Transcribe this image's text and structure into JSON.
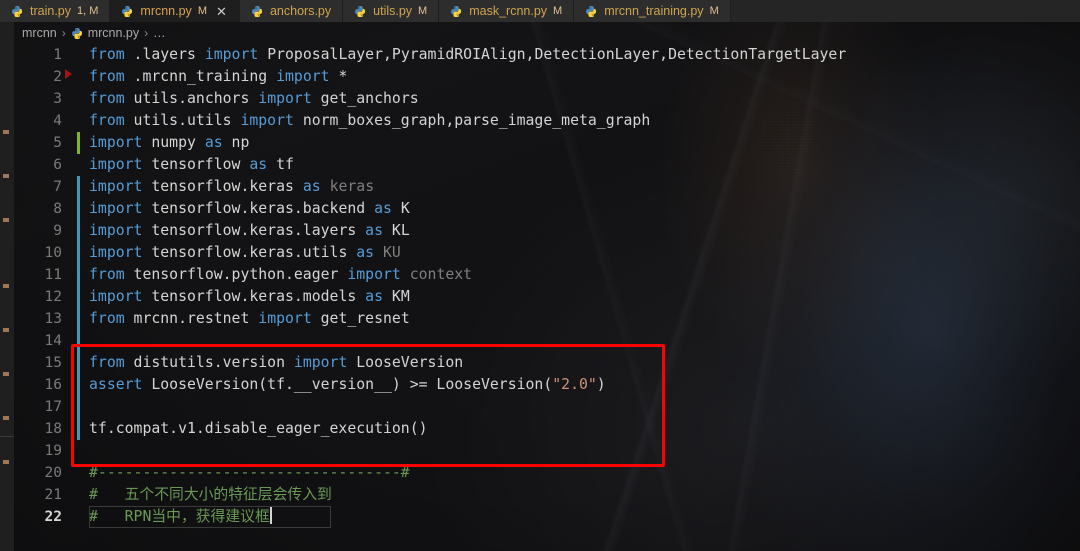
{
  "window": {
    "accent_red": "#ff0000",
    "editor_bg": "#1e1e1e",
    "tabbar_bg": "#252526"
  },
  "tabs": [
    {
      "name": "train.py",
      "label": "train.py",
      "badge": "1, M",
      "active": false,
      "icon": "python-file-icon",
      "closable": false
    },
    {
      "name": "mrcnn.py",
      "label": "mrcnn.py",
      "badge": "M",
      "active": true,
      "icon": "python-file-icon",
      "closable": true,
      "close": "✕"
    },
    {
      "name": "anchors.py",
      "label": "anchors.py",
      "badge": "",
      "active": false,
      "icon": "python-file-icon",
      "closable": false
    },
    {
      "name": "utils.py",
      "label": "utils.py",
      "badge": "M",
      "active": false,
      "icon": "python-file-icon",
      "closable": false
    },
    {
      "name": "mask_rcnn.py",
      "label": "mask_rcnn.py",
      "badge": "M",
      "active": false,
      "icon": "python-file-icon",
      "closable": false
    },
    {
      "name": "mrcnn_training.py",
      "label": "mrcnn_training.py",
      "badge": "M",
      "active": false,
      "icon": "python-file-icon",
      "closable": false
    }
  ],
  "breadcrumb": {
    "folder": "mrcnn",
    "sep1": "›",
    "file": "mrcnn.py",
    "sep2": "›",
    "ellipsis": "…"
  },
  "code": {
    "lines": [
      {
        "n": "1",
        "git": "",
        "breakpoint": false,
        "current": false,
        "tokens": [
          {
            "t": "from",
            "c": "kw"
          },
          {
            "t": " .layers ",
            "c": "plain"
          },
          {
            "t": "import",
            "c": "kw"
          },
          {
            "t": " ProposalLayer,PyramidROIAlign,DetectionLayer,DetectionTargetLayer",
            "c": "plain"
          }
        ]
      },
      {
        "n": "2",
        "git": "",
        "breakpoint": true,
        "current": false,
        "tokens": [
          {
            "t": "from",
            "c": "kw"
          },
          {
            "t": " .mrcnn_training ",
            "c": "plain"
          },
          {
            "t": "import",
            "c": "kw"
          },
          {
            "t": " *",
            "c": "plain"
          }
        ]
      },
      {
        "n": "3",
        "git": "",
        "breakpoint": false,
        "current": false,
        "tokens": [
          {
            "t": "from",
            "c": "kw"
          },
          {
            "t": " utils.anchors ",
            "c": "plain"
          },
          {
            "t": "import",
            "c": "kw"
          },
          {
            "t": " get_anchors",
            "c": "plain"
          }
        ]
      },
      {
        "n": "4",
        "git": "",
        "breakpoint": false,
        "current": false,
        "tokens": [
          {
            "t": "from",
            "c": "kw"
          },
          {
            "t": " utils.utils ",
            "c": "plain"
          },
          {
            "t": "import",
            "c": "kw"
          },
          {
            "t": " norm_boxes_graph,parse_image_meta_graph",
            "c": "plain"
          }
        ]
      },
      {
        "n": "5",
        "git": "add",
        "breakpoint": false,
        "current": false,
        "tokens": [
          {
            "t": "import",
            "c": "kw"
          },
          {
            "t": " numpy ",
            "c": "plain"
          },
          {
            "t": "as",
            "c": "kw"
          },
          {
            "t": " np",
            "c": "plain"
          }
        ]
      },
      {
        "n": "6",
        "git": "",
        "breakpoint": false,
        "current": false,
        "tokens": [
          {
            "t": "import",
            "c": "kw"
          },
          {
            "t": " tensorflow ",
            "c": "plain"
          },
          {
            "t": "as",
            "c": "kw"
          },
          {
            "t": " tf",
            "c": "plain"
          }
        ]
      },
      {
        "n": "7",
        "git": "mod",
        "breakpoint": false,
        "current": false,
        "tokens": [
          {
            "t": "import",
            "c": "kw"
          },
          {
            "t": " tensorflow.keras ",
            "c": "plain"
          },
          {
            "t": "as",
            "c": "kw"
          },
          {
            "t": " ",
            "c": "plain"
          },
          {
            "t": "keras",
            "c": "dim"
          }
        ]
      },
      {
        "n": "8",
        "git": "mod",
        "breakpoint": false,
        "current": false,
        "tokens": [
          {
            "t": "import",
            "c": "kw"
          },
          {
            "t": " tensorflow.keras.backend ",
            "c": "plain"
          },
          {
            "t": "as",
            "c": "kw"
          },
          {
            "t": " K",
            "c": "plain"
          }
        ]
      },
      {
        "n": "9",
        "git": "mod",
        "breakpoint": false,
        "current": false,
        "tokens": [
          {
            "t": "import",
            "c": "kw"
          },
          {
            "t": " tensorflow.keras.layers ",
            "c": "plain"
          },
          {
            "t": "as",
            "c": "kw"
          },
          {
            "t": " KL",
            "c": "plain"
          }
        ]
      },
      {
        "n": "10",
        "git": "mod",
        "breakpoint": false,
        "current": false,
        "tokens": [
          {
            "t": "import",
            "c": "kw"
          },
          {
            "t": " tensorflow.keras.utils ",
            "c": "plain"
          },
          {
            "t": "as",
            "c": "kw"
          },
          {
            "t": " ",
            "c": "plain"
          },
          {
            "t": "KU",
            "c": "dim"
          }
        ]
      },
      {
        "n": "11",
        "git": "mod",
        "breakpoint": false,
        "current": false,
        "tokens": [
          {
            "t": "from",
            "c": "kw"
          },
          {
            "t": " tensorflow.python.eager ",
            "c": "plain"
          },
          {
            "t": "import",
            "c": "kw"
          },
          {
            "t": " ",
            "c": "plain"
          },
          {
            "t": "context",
            "c": "dim"
          }
        ]
      },
      {
        "n": "12",
        "git": "mod",
        "breakpoint": false,
        "current": false,
        "tokens": [
          {
            "t": "import",
            "c": "kw"
          },
          {
            "t": " tensorflow.keras.models ",
            "c": "plain"
          },
          {
            "t": "as",
            "c": "kw"
          },
          {
            "t": " KM",
            "c": "plain"
          }
        ]
      },
      {
        "n": "13",
        "git": "mod",
        "breakpoint": false,
        "current": false,
        "tokens": [
          {
            "t": "from",
            "c": "kw"
          },
          {
            "t": " mrcnn.restnet ",
            "c": "plain"
          },
          {
            "t": "import",
            "c": "kw"
          },
          {
            "t": " get_resnet",
            "c": "plain"
          }
        ]
      },
      {
        "n": "14",
        "git": "mod",
        "breakpoint": false,
        "current": false,
        "tokens": []
      },
      {
        "n": "15",
        "git": "mod",
        "breakpoint": false,
        "current": false,
        "tokens": [
          {
            "t": "from",
            "c": "kw"
          },
          {
            "t": " distutils.version ",
            "c": "plain"
          },
          {
            "t": "import",
            "c": "kw"
          },
          {
            "t": " LooseVersion",
            "c": "plain"
          }
        ]
      },
      {
        "n": "16",
        "git": "mod",
        "breakpoint": false,
        "current": false,
        "tokens": [
          {
            "t": "assert",
            "c": "kw"
          },
          {
            "t": " LooseVersion(tf.__version__) >= LooseVersion(",
            "c": "plain"
          },
          {
            "t": "\"2.0\"",
            "c": "str"
          },
          {
            "t": ")",
            "c": "plain"
          }
        ]
      },
      {
        "n": "17",
        "git": "mod",
        "breakpoint": false,
        "current": false,
        "tokens": []
      },
      {
        "n": "18",
        "git": "mod",
        "breakpoint": false,
        "current": false,
        "tokens": [
          {
            "t": "tf.compat.v1.disable_eager_execution()",
            "c": "plain"
          }
        ]
      },
      {
        "n": "19",
        "git": "",
        "breakpoint": false,
        "current": false,
        "tokens": []
      },
      {
        "n": "20",
        "git": "",
        "breakpoint": false,
        "current": false,
        "tokens": [
          {
            "t": "#----------------------------------#",
            "c": "cmt"
          }
        ]
      },
      {
        "n": "21",
        "git": "",
        "breakpoint": false,
        "current": false,
        "tokens": [
          {
            "t": "#   五个不同大小的特征层会传入到",
            "c": "cmt"
          }
        ]
      },
      {
        "n": "22",
        "git": "",
        "breakpoint": false,
        "current": true,
        "caret": true,
        "tokens": [
          {
            "t": "#   RPN当中，获得建议框",
            "c": "cmt"
          }
        ]
      }
    ]
  },
  "annotation": {
    "name": "red-highlight-rectangle",
    "color": "#ff0000",
    "covers_lines": "14-18"
  },
  "gutter": {
    "breakpoint_color": "#a31515",
    "git_added_color": "#81b71a",
    "git_modified_color": "#4595b7"
  }
}
